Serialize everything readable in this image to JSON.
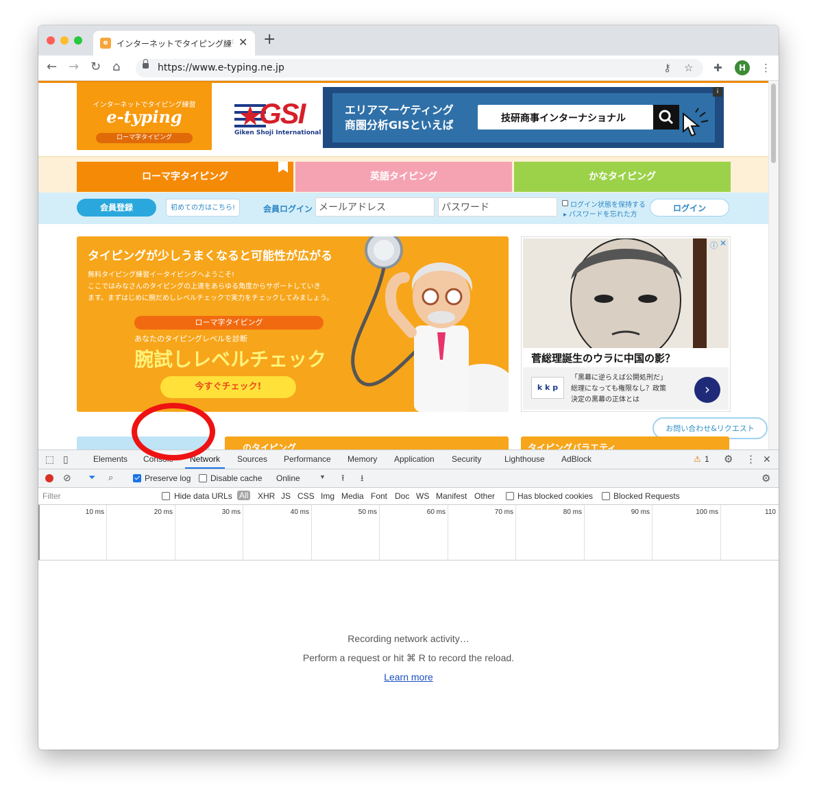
{
  "browser": {
    "tab": {
      "title": "インターネットでタイピング練習 -",
      "favicon": "e-typing-favicon"
    },
    "new_tab_label": "+",
    "url": "https://www.e-typing.ne.jp",
    "profile_initial": "H"
  },
  "site": {
    "logo": {
      "tagline": "インターネットでタイピング練習",
      "name": "e-typing",
      "sub": "ローマ字タイピング"
    },
    "sponsor_logo": {
      "name": "GSI",
      "sub": "Giken Shoji International"
    },
    "banner": {
      "line1": "エリアマーケティング",
      "line2": "商圏分析GISといえば",
      "search_text": "技研商事インターナショナル",
      "info_badge": "i"
    },
    "categories": [
      {
        "label": "ローマ字タイピング",
        "color": "#f58a07"
      },
      {
        "label": "英語タイピング",
        "color": "#f5a3b3"
      },
      {
        "label": "かなタイピング",
        "color": "#9bd24a"
      }
    ],
    "login": {
      "register_label": "会員登録",
      "first_time_label": "初めての方はこちら!",
      "member_login_label": "会員ログイン",
      "email_placeholder": "メールアドレス",
      "password_placeholder": "パスワード",
      "keep_login_label": "ログイン状態を保持する",
      "forgot_label": "パスワードを忘れた方",
      "login_button": "ログイン"
    },
    "hero": {
      "title": "タイピングが少しうまくなると可能性が広がる",
      "desc_line1": "無料タイピング練習イータイピングへようこそ!",
      "desc_line2": "ここではみなさんのタイピングの上達をあらゆる角度からサポートしていき",
      "desc_line3": "ます。まずはじめに腕だめしレベルチェックで実力をチェックしてみましょう。",
      "badge": "ローマ字タイピング",
      "sub": "あなたのタイピングレベルを診断",
      "big": "腕試しレベルチェック",
      "button": "今すぐチェック!"
    },
    "ad": {
      "headline": "菅総理誕生のウラに中国の影？",
      "logo": "k k p",
      "desc_line1": "「黒幕に逆らえば公開処刑だ」",
      "desc_line2": "総理になっても権限なし？政策",
      "desc_line3": "決定の黒幕の正体とは"
    },
    "contact_label": "お問い合わせ&リクエスト",
    "lower_cards": [
      {
        "label": "",
        "color": "#bfe4f5"
      },
      {
        "label": "のタイピング",
        "color": "#f7a51a"
      },
      {
        "label": "タイピングバラエティ",
        "color": "#f7a51a"
      }
    ]
  },
  "devtools": {
    "tabs": [
      "Elements",
      "Console",
      "Network",
      "Sources",
      "Performance",
      "Memory",
      "Application",
      "Security",
      "Lighthouse",
      "AdBlock"
    ],
    "active_tab": "Network",
    "warning_count": "1",
    "toolbar": {
      "preserve_log": "Preserve log",
      "preserve_checked": true,
      "disable_cache": "Disable cache",
      "disable_checked": false,
      "throttling": "Online"
    },
    "filter": {
      "placeholder": "Filter",
      "hide_data_urls": "Hide data URLs",
      "types": [
        "All",
        "XHR",
        "JS",
        "CSS",
        "Img",
        "Media",
        "Font",
        "Doc",
        "WS",
        "Manifest",
        "Other"
      ],
      "active_type": "All",
      "has_blocked_cookies": "Has blocked cookies",
      "blocked_requests": "Blocked Requests"
    },
    "timeline_ticks": [
      "10 ms",
      "20 ms",
      "30 ms",
      "40 ms",
      "50 ms",
      "60 ms",
      "70 ms",
      "80 ms",
      "90 ms",
      "100 ms",
      "110"
    ],
    "empty": {
      "recording": "Recording network activity…",
      "perform": "Perform a request or hit ⌘ R to record the reload.",
      "learn_more": "Learn more"
    }
  },
  "colors": {
    "accent": "#1a73e8",
    "brand_orange": "#f79a0e",
    "annotation_red": "#ee1212",
    "close_dot": "#fe5f57",
    "min_dot": "#febc2e",
    "max_dot": "#28c840"
  }
}
